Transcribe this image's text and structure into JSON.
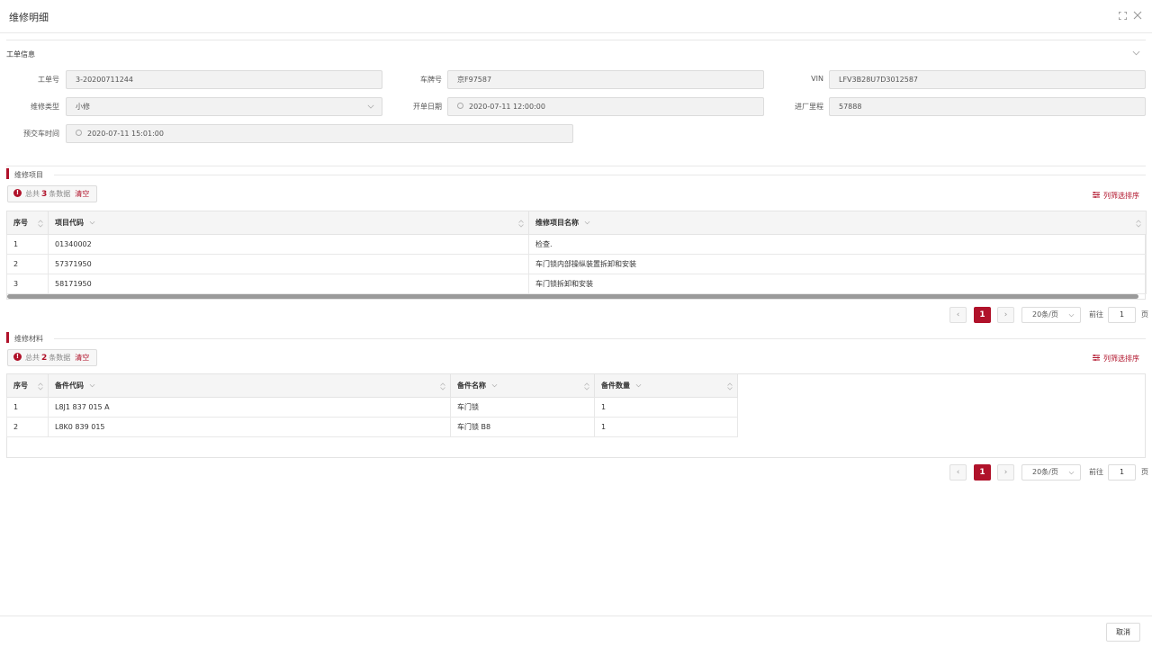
{
  "dialog": {
    "title": "维修明细"
  },
  "work_order": {
    "group_title": "工单信息",
    "fields": {
      "order_no": {
        "label": "工单号",
        "value": "3-20200711244"
      },
      "plate": {
        "label": "车牌号",
        "value": "京F97587"
      },
      "vin": {
        "label": "VIN",
        "value": "LFV3B28U7D3012587"
      },
      "repair_type": {
        "label": "维修类型",
        "value": "小修"
      },
      "open_date": {
        "label": "开单日期",
        "value": "2020-07-11 12:00:00"
      },
      "mileage": {
        "label": "进厂里程",
        "value": "57888"
      },
      "delivery_time": {
        "label": "预交车时间",
        "value": "2020-07-11 15:01:00"
      }
    }
  },
  "repair_items": {
    "title": "维修项目",
    "info_prefix": "总共",
    "count": "3",
    "info_suffix": "条数据",
    "clear_label": "清空",
    "filter_label": "列筛选排序",
    "columns": [
      "序号",
      "项目代码",
      "维修项目名称"
    ],
    "rows": [
      {
        "idx": "1",
        "code": "01340002",
        "name": "检查."
      },
      {
        "idx": "2",
        "code": "57371950",
        "name": "车门锁内部操纵装置拆卸和安装"
      },
      {
        "idx": "3",
        "code": "58171950",
        "name": "车门锁拆卸和安装"
      }
    ],
    "pager": {
      "page": "1",
      "page_size": "20条/页",
      "goto_prefix": "前往",
      "goto_value": "1",
      "goto_suffix": "页"
    }
  },
  "repair_materials": {
    "title": "维修材料",
    "info_prefix": "总共",
    "count": "2",
    "info_suffix": "条数据",
    "clear_label": "清空",
    "filter_label": "列筛选排序",
    "columns": [
      "序号",
      "备件代码",
      "备件名称",
      "备件数量"
    ],
    "rows": [
      {
        "idx": "1",
        "code": "L8J1 837 015 A",
        "name": "车门锁",
        "qty": "1"
      },
      {
        "idx": "2",
        "code": "L8K0 839 015",
        "name": "车门锁 B8",
        "qty": "1"
      }
    ],
    "pager": {
      "page": "1",
      "page_size": "20条/页",
      "goto_prefix": "前往",
      "goto_value": "1",
      "goto_suffix": "页"
    }
  },
  "footer": {
    "cancel_label": "取消"
  },
  "colors": {
    "accent": "#b0122a",
    "input_bg": "#f2f2f2",
    "header_bg": "#f5f5f5"
  }
}
